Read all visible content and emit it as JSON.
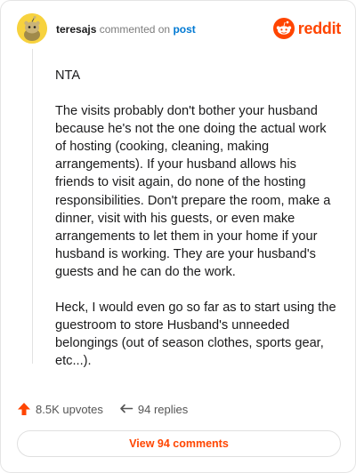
{
  "comment": {
    "username": "teresajs",
    "action_text": "commented on",
    "post_link": "post",
    "paragraphs": [
      "NTA",
      "The visits probably don't bother your husband because he's not the one doing the actual work of hosting (cooking, cleaning, making arrangements). If your husband allows his friends to visit again, do none of the hosting responsibilities. Don't prepare the room, make a dinner, visit with his guests, or even make arrangements to let them in your home if your husband is working. They are your husband's guests and he can do the work.",
      "Heck, I would even go so far as to start using the guestroom to store Husband's unneeded belongings (out of season clothes, sports gear, etc...)."
    ],
    "upvotes": "8.5K upvotes",
    "replies": "94 replies",
    "view_button": "View 94 comments"
  },
  "brand": {
    "logo_text": "reddit",
    "color": "#ff4500"
  },
  "icons": {
    "avatar": "snoo-avatar-icon",
    "logo": "reddit-logo-icon",
    "upvote": "upvote-arrow-icon",
    "reply": "reply-arrow-icon"
  }
}
